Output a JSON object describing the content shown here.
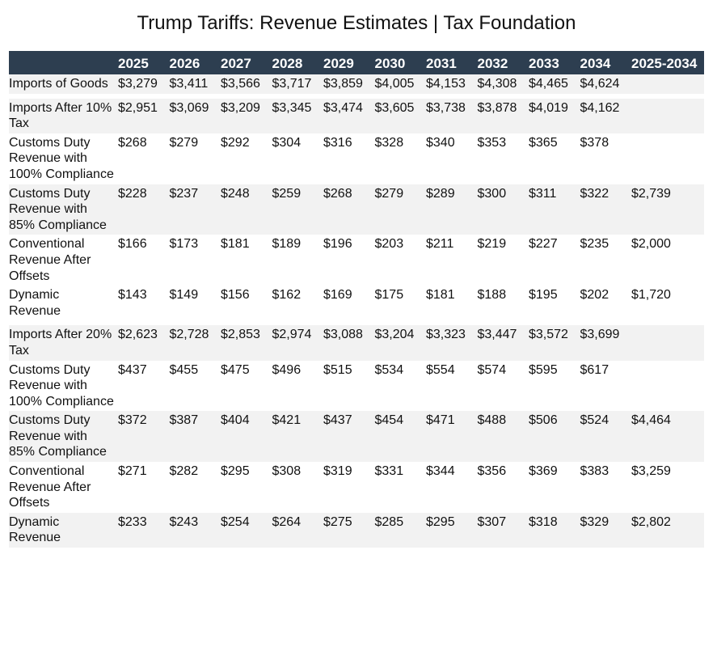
{
  "title": "Trump Tariffs: Revenue Estimates | Tax Foundation",
  "header": {
    "years": [
      "2025",
      "2026",
      "2027",
      "2028",
      "2029",
      "2030",
      "2031",
      "2032",
      "2033",
      "2034"
    ],
    "total": "2025-2034"
  },
  "colors": {
    "header_background": "#2d3e50",
    "row_shading": "#f2f2f2"
  },
  "rows": [
    {
      "label": "Imports of Goods",
      "values": [
        "$3,279",
        "$3,411",
        "$3,566",
        "$3,717",
        "$3,859",
        "$4,005",
        "$4,153",
        "$4,308",
        "$4,465",
        "$4,624"
      ],
      "total": ""
    },
    {
      "label": "Imports After 10% Tax",
      "values": [
        "$2,951",
        "$3,069",
        "$3,209",
        "$3,345",
        "$3,474",
        "$3,605",
        "$3,738",
        "$3,878",
        "$4,019",
        "$4,162"
      ],
      "total": ""
    },
    {
      "label": "Customs Duty Revenue with 100% Compliance",
      "values": [
        "$268",
        "$279",
        "$292",
        "$304",
        "$316",
        "$328",
        "$340",
        "$353",
        "$365",
        "$378"
      ],
      "total": ""
    },
    {
      "label": "Customs Duty Revenue with 85% Compliance",
      "values": [
        "$228",
        "$237",
        "$248",
        "$259",
        "$268",
        "$279",
        "$289",
        "$300",
        "$311",
        "$322"
      ],
      "total": "$2,739"
    },
    {
      "label": "Conventional Revenue After Offsets",
      "values": [
        "$166",
        "$173",
        "$181",
        "$189",
        "$196",
        "$203",
        "$211",
        "$219",
        "$227",
        "$235"
      ],
      "total": "$2,000"
    },
    {
      "label": "Dynamic Revenue",
      "values": [
        "$143",
        "$149",
        "$156",
        "$162",
        "$169",
        "$175",
        "$181",
        "$188",
        "$195",
        "$202"
      ],
      "total": "$1,720"
    },
    {
      "label": "Imports After 20% Tax",
      "values": [
        "$2,623",
        "$2,728",
        "$2,853",
        "$2,974",
        "$3,088",
        "$3,204",
        "$3,323",
        "$3,447",
        "$3,572",
        "$3,699"
      ],
      "total": ""
    },
    {
      "label": "Customs Duty Revenue with 100% Compliance",
      "values": [
        "$437",
        "$455",
        "$475",
        "$496",
        "$515",
        "$534",
        "$554",
        "$574",
        "$595",
        "$617"
      ],
      "total": ""
    },
    {
      "label": "Customs Duty Revenue with 85% Compliance",
      "values": [
        "$372",
        "$387",
        "$404",
        "$421",
        "$437",
        "$454",
        "$471",
        "$488",
        "$506",
        "$524"
      ],
      "total": "$4,464"
    },
    {
      "label": "Conventional Revenue After Offsets",
      "values": [
        "$271",
        "$282",
        "$295",
        "$308",
        "$319",
        "$331",
        "$344",
        "$356",
        "$369",
        "$383"
      ],
      "total": "$3,259"
    },
    {
      "label": "Dynamic Revenue",
      "values": [
        "$233",
        "$243",
        "$254",
        "$264",
        "$275",
        "$285",
        "$295",
        "$307",
        "$318",
        "$329"
      ],
      "total": "$2,802"
    }
  ]
}
